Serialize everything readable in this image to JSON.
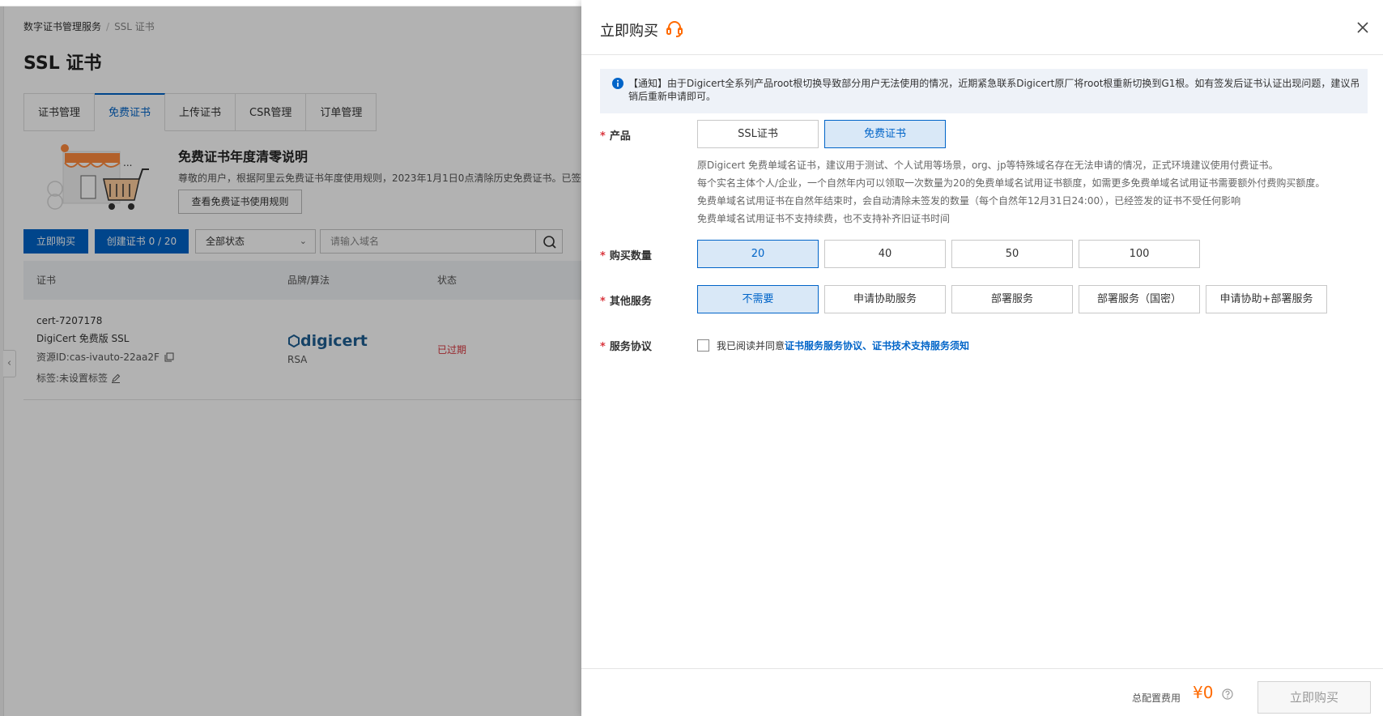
{
  "breadcrumb": {
    "root": "数字证书管理服务",
    "current": "SSL 证书"
  },
  "page": {
    "title": "SSL 证书"
  },
  "tabs": [
    "证书管理",
    "免费证书",
    "上传证书",
    "CSR管理",
    "订单管理"
  ],
  "promo": {
    "title": "免费证书年度清零说明",
    "desc": "尊敬的用户，根据阿里云免费证书年度使用规则，2023年1月1日0点清除历史免费证书。已签发",
    "button": "查看免费证书使用规则"
  },
  "toolbar": {
    "buy_label": "立即购买",
    "create_label": "创建证书 0 / 20",
    "status_value": "全部状态",
    "search_placeholder": "请输入域名"
  },
  "table": {
    "headers": [
      "证书",
      "品牌/算法",
      "状态"
    ],
    "row": {
      "cert_id": "cert-7207178",
      "cert_name": "DigiCert 免费版 SSL",
      "resource_id": "资源ID:cas-ivauto-22aa2F",
      "tag": "标签:未设置标签",
      "brand": "digicert",
      "algorithm": "RSA",
      "status": "已过期"
    }
  },
  "drawer": {
    "title": "立即购买",
    "notice": "【通知】由于Digicert全系列产品root根切换导致部分用户无法使用的情况，近期紧急联系Digicert原厂将root根重新切换到G1根。如有签发后证书认证出现问题，建议吊销后重新申请即可。",
    "product": {
      "label": "产品",
      "options": [
        "SSL证书",
        "免费证书"
      ],
      "selected": "免费证书",
      "desc": [
        "原Digicert 免费单域名证书，建议用于测试、个人试用等场景，org、jp等特殊域名存在无法申请的情况，正式环境建议使用付费证书。",
        "每个实名主体个人/企业，一个自然年内可以领取一次数量为20的免费单域名试用证书额度，如需更多免费单域名试用证书需要额外付费购买额度。",
        "免费单域名试用证书在自然年结束时，会自动清除未签发的数量（每个自然年12月31日24:00），已经签发的证书不受任何影响",
        "免费单域名试用证书不支持续费，也不支持补齐旧证书时间"
      ]
    },
    "quantity": {
      "label": "购买数量",
      "options": [
        "20",
        "40",
        "50",
        "100"
      ],
      "selected": "20"
    },
    "services": {
      "label": "其他服务",
      "options": [
        "不需要",
        "申请协助服务",
        "部署服务",
        "部署服务（国密）",
        "申请协助+部署服务"
      ],
      "selected": "不需要"
    },
    "agreement": {
      "label": "服务协议",
      "text": "我已阅读并同意",
      "link": "证书服务服务协议、证书技术支持服务须知",
      "checked": false
    },
    "footer": {
      "fee_label": "总配置费用",
      "fee_value": "¥0",
      "buy_label": "立即购买"
    }
  },
  "colors": {
    "primary": "#0064c8",
    "danger": "#d9363e",
    "price": "#ff6a00",
    "selected_bg": "#d9e8f7"
  }
}
